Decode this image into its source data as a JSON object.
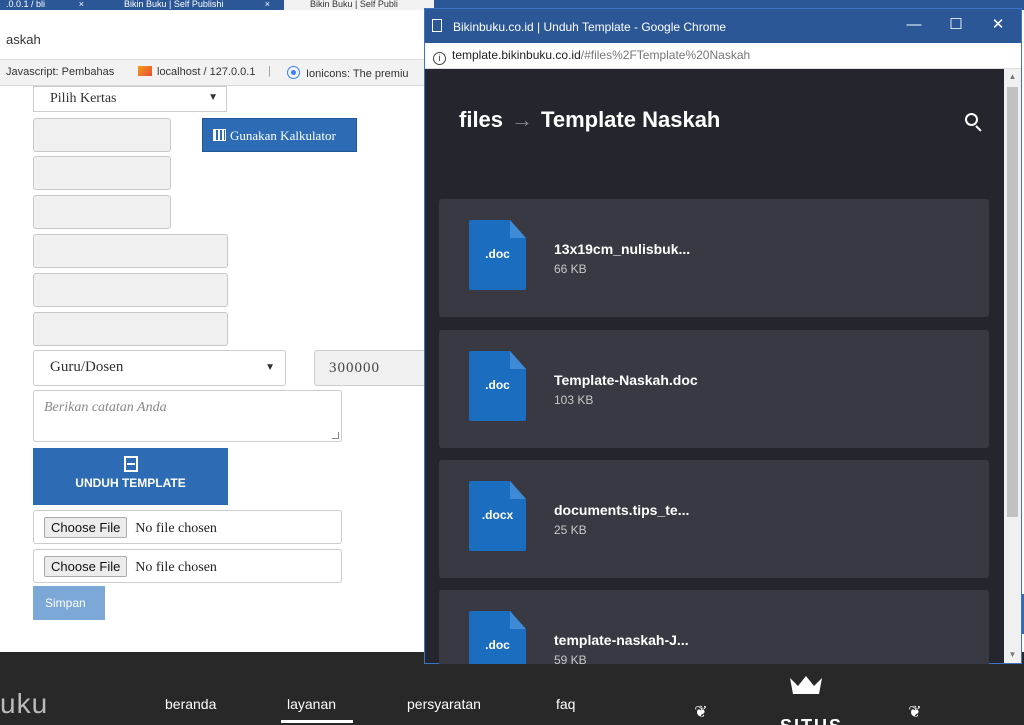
{
  "background_browser": {
    "tabs": [
      {
        "label": ".0.0.1 / bli"
      },
      {
        "label": "Bikin Buku | Self Publishi"
      },
      {
        "label": "Bikin Buku | Self Publi"
      }
    ],
    "url_fragment": "askah",
    "bookmarks": [
      {
        "label": "Javascript: Pembahas"
      },
      {
        "label": "localhost / 127.0.0.1"
      },
      {
        "label": "Ionicons: The premiu"
      }
    ]
  },
  "form": {
    "paper_select": "Pilih Kertas",
    "calc_button": "Gunakan Kalkulator",
    "role_select": "Guru/Dosen",
    "price_value": "300000",
    "notes_placeholder": "Berikan catatan Anda",
    "download_button": "UNDUH TEMPLATE",
    "file_inputs": [
      {
        "button": "Choose File",
        "status": "No file chosen"
      },
      {
        "button": "Choose File",
        "status": "No file chosen"
      }
    ],
    "save_button": "Simpan"
  },
  "footer": {
    "logo": "uku",
    "nav": [
      "beranda",
      "layanan",
      "persyaratan",
      "faq"
    ],
    "badge_text": "SITUS"
  },
  "popup": {
    "window_title": "Bikinbuku.co.id | Unduh Template - Google Chrome",
    "url_host": "template.bikinbuku.co.id",
    "url_path": "/#files%2FTemplate%20Naskah",
    "breadcrumb_root": "files",
    "breadcrumb_arrow": "→",
    "breadcrumb_current": "Template Naskah",
    "files": [
      {
        "ext": ".doc",
        "name": "13x19cm_nulisbuk...",
        "size": "66 KB"
      },
      {
        "ext": ".doc",
        "name": "Template-Naskah.doc",
        "size": "103 KB"
      },
      {
        "ext": ".docx",
        "name": "documents.tips_te...",
        "size": "25 KB"
      },
      {
        "ext": ".doc",
        "name": "template-naskah-J...",
        "size": "59 KB"
      }
    ]
  },
  "colors": {
    "accent": "#2d6cb5",
    "popup_bg": "#25262d",
    "card_bg": "#383942",
    "doc_icon": "#1b6dbf",
    "title_bar": "#2b5797"
  }
}
